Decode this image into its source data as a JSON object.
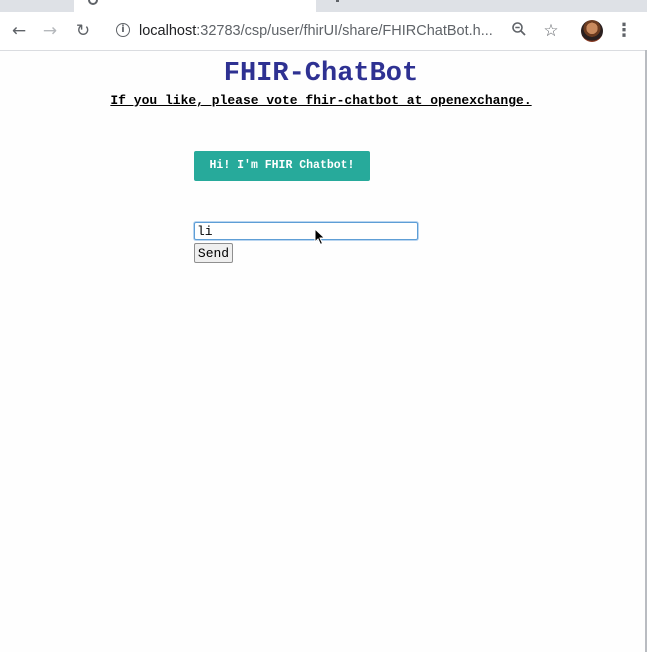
{
  "browser": {
    "nav": {
      "back_icon": "arrow-left",
      "forward_icon": "arrow-right",
      "reload_icon": "reload"
    },
    "address_bar": {
      "host": "localhost",
      "path": ":32783/csp/user/fhirUI/share/FHIRChatBot.h...",
      "info_icon": "info-circle",
      "zoom_icon": "magnifier-minus",
      "bookmark_icon": "star-outline"
    },
    "menu_icon": "three-dots-vertical"
  },
  "page": {
    "title": "FHIR-ChatBot",
    "vote_text": "If you like, please vote fhir-chatbot at openexchange.",
    "bot_message": "Hi! I'm FHIR Chatbot!",
    "input_value": "li",
    "send_label": "Send"
  },
  "colors": {
    "title": "#2e3192",
    "bot_bubble": "#27aa9b",
    "bot_text": "#ffffff",
    "input_focus": "#5e9ed6"
  }
}
